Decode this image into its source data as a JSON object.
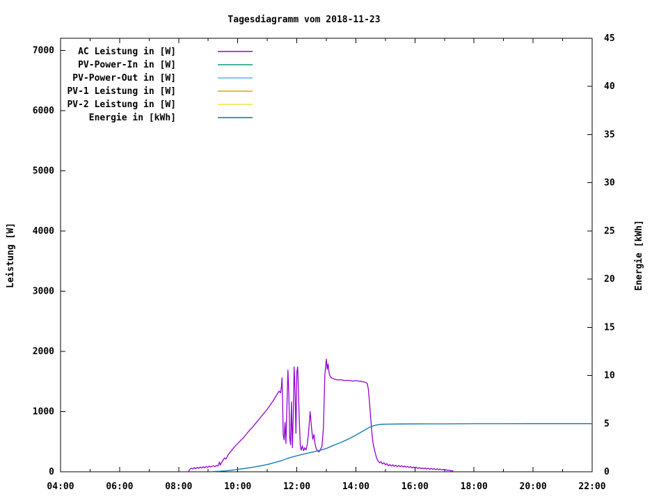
{
  "title": "Tagesdiagramm vom 2018-11-23",
  "chart_data": {
    "type": "line",
    "title": "Tagesdiagramm vom 2018-11-23",
    "legend_position": "top-left-inside",
    "grid": false,
    "x_axis": {
      "range_hours": [
        4,
        22
      ],
      "minor_tick_every_hours": 1,
      "ticks": [
        {
          "h": 4,
          "label": "04:00"
        },
        {
          "h": 6,
          "label": "06:00"
        },
        {
          "h": 8,
          "label": "08:00"
        },
        {
          "h": 10,
          "label": "10:00"
        },
        {
          "h": 12,
          "label": "12:00"
        },
        {
          "h": 14,
          "label": "14:00"
        },
        {
          "h": 16,
          "label": "16:00"
        },
        {
          "h": 18,
          "label": "18:00"
        },
        {
          "h": 20,
          "label": "20:00"
        },
        {
          "h": 22,
          "label": "22:00"
        }
      ]
    },
    "y_left": {
      "label": "Leistung [W]",
      "range": [
        0,
        7200
      ],
      "ticks": [
        {
          "v": 0,
          "label": "0"
        },
        {
          "v": 1000,
          "label": "1000"
        },
        {
          "v": 2000,
          "label": "2000"
        },
        {
          "v": 3000,
          "label": "3000"
        },
        {
          "v": 4000,
          "label": "4000"
        },
        {
          "v": 5000,
          "label": "5000"
        },
        {
          "v": 6000,
          "label": "6000"
        },
        {
          "v": 7000,
          "label": "7000"
        }
      ]
    },
    "y_right": {
      "label": "Energie [kWh]",
      "range": [
        0,
        45
      ],
      "ticks": [
        {
          "v": 0,
          "label": "0"
        },
        {
          "v": 5,
          "label": "5"
        },
        {
          "v": 10,
          "label": "10"
        },
        {
          "v": 15,
          "label": "15"
        },
        {
          "v": 20,
          "label": "20"
        },
        {
          "v": 25,
          "label": "25"
        },
        {
          "v": 30,
          "label": "30"
        },
        {
          "v": 35,
          "label": "35"
        },
        {
          "v": 40,
          "label": "40"
        },
        {
          "v": 45,
          "label": "45"
        }
      ]
    },
    "series": [
      {
        "name": "AC Leistung in [W]",
        "id": "ac-leistung",
        "color": "#9400d3",
        "axis": "left",
        "points": [
          [
            8.33,
            5
          ],
          [
            8.38,
            40
          ],
          [
            8.43,
            60
          ],
          [
            8.48,
            45
          ],
          [
            8.53,
            70
          ],
          [
            8.58,
            50
          ],
          [
            8.63,
            75
          ],
          [
            8.68,
            55
          ],
          [
            8.73,
            80
          ],
          [
            8.78,
            60
          ],
          [
            8.83,
            85
          ],
          [
            8.88,
            65
          ],
          [
            8.93,
            90
          ],
          [
            8.98,
            70
          ],
          [
            9.03,
            95
          ],
          [
            9.08,
            80
          ],
          [
            9.13,
            90
          ],
          [
            9.18,
            100
          ],
          [
            9.23,
            85
          ],
          [
            9.28,
            105
          ],
          [
            9.33,
            95
          ],
          [
            9.38,
            160
          ],
          [
            9.41,
            110
          ],
          [
            9.45,
            150
          ],
          [
            9.5,
            190
          ],
          [
            9.55,
            230
          ],
          [
            9.6,
            210
          ],
          [
            9.65,
            260
          ],
          [
            9.7,
            300
          ],
          [
            9.75,
            330
          ],
          [
            9.8,
            360
          ],
          [
            9.9,
            420
          ],
          [
            10.0,
            470
          ],
          [
            10.1,
            520
          ],
          [
            10.2,
            570
          ],
          [
            10.3,
            630
          ],
          [
            10.4,
            690
          ],
          [
            10.5,
            740
          ],
          [
            10.6,
            800
          ],
          [
            10.7,
            860
          ],
          [
            10.8,
            920
          ],
          [
            10.9,
            980
          ],
          [
            11.0,
            1040
          ],
          [
            11.1,
            1110
          ],
          [
            11.2,
            1180
          ],
          [
            11.3,
            1260
          ],
          [
            11.4,
            1340
          ],
          [
            11.45,
            1310
          ],
          [
            11.48,
            1420
          ],
          [
            11.5,
            1560
          ],
          [
            11.52,
            1150
          ],
          [
            11.54,
            620
          ],
          [
            11.57,
            530
          ],
          [
            11.6,
            820
          ],
          [
            11.63,
            470
          ],
          [
            11.67,
            1150
          ],
          [
            11.7,
            1690
          ],
          [
            11.73,
            1280
          ],
          [
            11.76,
            560
          ],
          [
            11.79,
            450
          ],
          [
            11.82,
            1160
          ],
          [
            11.85,
            400
          ],
          [
            11.88,
            950
          ],
          [
            11.91,
            1740
          ],
          [
            11.94,
            1350
          ],
          [
            11.97,
            640
          ],
          [
            12.0,
            1660
          ],
          [
            12.03,
            1740
          ],
          [
            12.06,
            1260
          ],
          [
            12.09,
            780
          ],
          [
            12.12,
            430
          ],
          [
            12.15,
            360
          ],
          [
            12.19,
            430
          ],
          [
            12.23,
            350
          ],
          [
            12.27,
            400
          ],
          [
            12.31,
            360
          ],
          [
            12.35,
            440
          ],
          [
            12.4,
            660
          ],
          [
            12.45,
            1000
          ],
          [
            12.5,
            720
          ],
          [
            12.54,
            540
          ],
          [
            12.58,
            620
          ],
          [
            12.62,
            450
          ],
          [
            12.66,
            380
          ],
          [
            12.7,
            350
          ],
          [
            12.75,
            330
          ],
          [
            12.8,
            370
          ],
          [
            12.85,
            420
          ],
          [
            12.9,
            720
          ],
          [
            12.95,
            1620
          ],
          [
            13.0,
            1870
          ],
          [
            13.03,
            1700
          ],
          [
            13.06,
            1790
          ],
          [
            13.1,
            1620
          ],
          [
            13.15,
            1570
          ],
          [
            13.22,
            1550
          ],
          [
            13.3,
            1535
          ],
          [
            13.4,
            1525
          ],
          [
            13.5,
            1530
          ],
          [
            13.6,
            1515
          ],
          [
            13.7,
            1520
          ],
          [
            13.8,
            1515
          ],
          [
            13.9,
            1505
          ],
          [
            14.0,
            1515
          ],
          [
            14.1,
            1505
          ],
          [
            14.2,
            1500
          ],
          [
            14.3,
            1490
          ],
          [
            14.38,
            1470
          ],
          [
            14.42,
            1380
          ],
          [
            14.46,
            1150
          ],
          [
            14.5,
            900
          ],
          [
            14.54,
            650
          ],
          [
            14.58,
            480
          ],
          [
            14.62,
            390
          ],
          [
            14.66,
            300
          ],
          [
            14.7,
            230
          ],
          [
            14.75,
            180
          ],
          [
            14.8,
            150
          ],
          [
            14.85,
            170
          ],
          [
            14.9,
            130
          ],
          [
            14.95,
            150
          ],
          [
            15.0,
            115
          ],
          [
            15.05,
            135
          ],
          [
            15.1,
            100
          ],
          [
            15.15,
            120
          ],
          [
            15.2,
            95
          ],
          [
            15.25,
            115
          ],
          [
            15.3,
            90
          ],
          [
            15.35,
            110
          ],
          [
            15.4,
            85
          ],
          [
            15.45,
            105
          ],
          [
            15.5,
            85
          ],
          [
            15.55,
            100
          ],
          [
            15.6,
            80
          ],
          [
            15.65,
            95
          ],
          [
            15.7,
            75
          ],
          [
            15.75,
            90
          ],
          [
            15.8,
            70
          ],
          [
            15.85,
            85
          ],
          [
            15.9,
            65
          ],
          [
            15.95,
            80
          ],
          [
            16.0,
            60
          ],
          [
            16.05,
            75
          ],
          [
            16.1,
            55
          ],
          [
            16.15,
            70
          ],
          [
            16.2,
            50
          ],
          [
            16.25,
            65
          ],
          [
            16.3,
            48
          ],
          [
            16.35,
            62
          ],
          [
            16.4,
            45
          ],
          [
            16.45,
            58
          ],
          [
            16.5,
            42
          ],
          [
            16.55,
            55
          ],
          [
            16.6,
            40
          ],
          [
            16.65,
            52
          ],
          [
            16.7,
            38
          ],
          [
            16.75,
            48
          ],
          [
            16.8,
            35
          ],
          [
            16.85,
            45
          ],
          [
            16.9,
            32
          ],
          [
            16.95,
            40
          ],
          [
            17.0,
            28
          ],
          [
            17.05,
            35
          ],
          [
            17.1,
            22
          ],
          [
            17.15,
            28
          ],
          [
            17.2,
            15
          ],
          [
            17.25,
            20
          ],
          [
            17.3,
            10
          ]
        ]
      },
      {
        "name": "PV-Power-In in [W]",
        "id": "pv-power-in",
        "color": "#009e73",
        "axis": "left",
        "points": []
      },
      {
        "name": "PV-Power-Out in [W]",
        "id": "pv-power-out",
        "color": "#56b4e9",
        "axis": "left",
        "points": []
      },
      {
        "name": "PV-1 Leistung in [W]",
        "id": "pv-1-leistung",
        "color": "#e69f00",
        "axis": "left",
        "points": []
      },
      {
        "name": "PV-2 Leistung in [W]",
        "id": "pv-2-leistung",
        "color": "#f0e442",
        "axis": "left",
        "points": []
      },
      {
        "name": "Energie in [kWh]",
        "id": "energie",
        "color": "#0072b2",
        "axis": "right",
        "points": [
          [
            9.15,
            0.02
          ],
          [
            9.4,
            0.06
          ],
          [
            9.6,
            0.1
          ],
          [
            9.8,
            0.17
          ],
          [
            10.0,
            0.25
          ],
          [
            10.25,
            0.35
          ],
          [
            10.5,
            0.47
          ],
          [
            10.75,
            0.6
          ],
          [
            11.0,
            0.75
          ],
          [
            11.25,
            0.95
          ],
          [
            11.5,
            1.18
          ],
          [
            11.75,
            1.45
          ],
          [
            12.0,
            1.66
          ],
          [
            12.25,
            1.85
          ],
          [
            12.5,
            2.02
          ],
          [
            12.75,
            2.2
          ],
          [
            13.0,
            2.42
          ],
          [
            13.25,
            2.75
          ],
          [
            13.5,
            3.05
          ],
          [
            13.75,
            3.4
          ],
          [
            14.0,
            3.8
          ],
          [
            14.25,
            4.25
          ],
          [
            14.45,
            4.6
          ],
          [
            14.6,
            4.78
          ],
          [
            14.75,
            4.88
          ],
          [
            14.9,
            4.93
          ],
          [
            15.1,
            4.95
          ],
          [
            15.5,
            4.96
          ],
          [
            16.0,
            4.97
          ],
          [
            16.5,
            4.98
          ],
          [
            17.0,
            4.98
          ],
          [
            18.0,
            4.99
          ],
          [
            19.0,
            4.99
          ],
          [
            20.0,
            5.0
          ],
          [
            21.0,
            5.0
          ],
          [
            22.0,
            5.0
          ]
        ]
      }
    ]
  }
}
